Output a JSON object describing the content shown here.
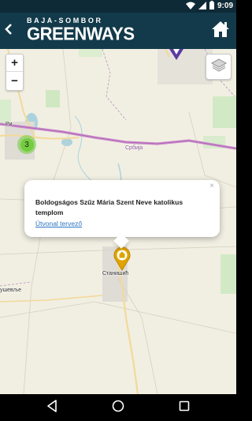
{
  "status_bar": {
    "time": "9:09",
    "icons": [
      "wifi-icon",
      "signal-icon",
      "battery-icon"
    ]
  },
  "header": {
    "logo_top": "BAJA-SOMBOR",
    "logo_main": "GREENWAYS",
    "back_icon": "chevron-left-icon",
    "home_icon": "home-icon"
  },
  "map": {
    "zoom_in_label": "+",
    "zoom_out_label": "−",
    "layers_icon": "layers-icon",
    "cluster_count": "3",
    "labels": {
      "ri": "Ри",
      "srbija": "Србија",
      "stanisic": "Станишић",
      "usevlje": "ушевље"
    }
  },
  "popup": {
    "close_label": "×",
    "title": "Boldogságos Szűz Mária Szent Neve katolikus templom",
    "link_label": "Útvonal tervező"
  },
  "nav_bar": {
    "icons": [
      "back-triangle-icon",
      "home-circle-icon",
      "recent-square-icon"
    ]
  },
  "colors": {
    "header_bg": "#123a4a",
    "status_bg": "#0e2a36",
    "border_purple": "#b469b8",
    "marker_gold": "#e0a400",
    "cluster_green": "#6ecc39",
    "link_blue": "#2b74c4"
  }
}
